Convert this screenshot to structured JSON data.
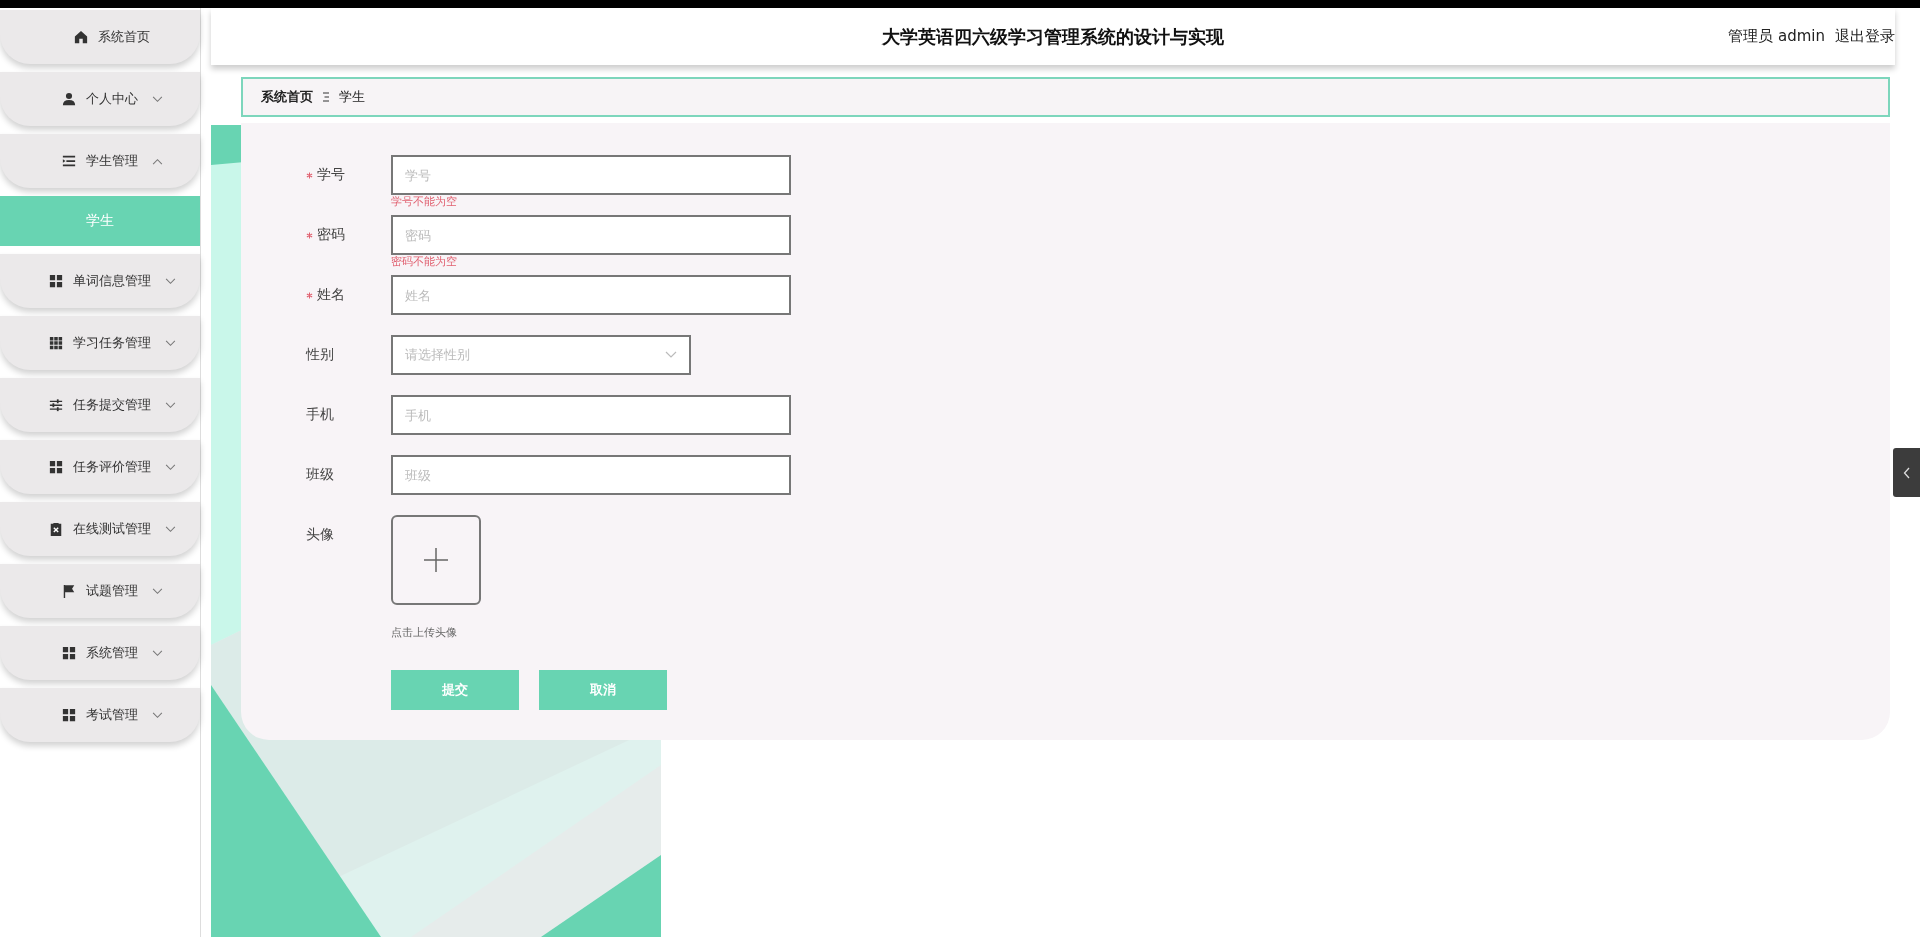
{
  "header": {
    "title": "大学英语四六级学习管理系统的设计与实现",
    "user": "管理员 admin",
    "logout": "退出登录"
  },
  "sidebar": {
    "items": [
      {
        "kind": "link",
        "label": "系统首页"
      },
      {
        "kind": "menu",
        "label": "个人中心",
        "expanded": false
      },
      {
        "kind": "menu",
        "label": "学生管理",
        "expanded": true,
        "children": [
          {
            "label": "学生",
            "selected": true
          }
        ]
      },
      {
        "kind": "menu",
        "label": "单词信息管理",
        "expanded": false
      },
      {
        "kind": "menu",
        "label": "学习任务管理",
        "expanded": false
      },
      {
        "kind": "menu",
        "label": "任务提交管理",
        "expanded": false
      },
      {
        "kind": "menu",
        "label": "任务评价管理",
        "expanded": false
      },
      {
        "kind": "menu",
        "label": "在线测试管理",
        "expanded": false
      },
      {
        "kind": "menu",
        "label": "试题管理",
        "expanded": false
      },
      {
        "kind": "menu",
        "label": "系统管理",
        "expanded": false
      },
      {
        "kind": "menu",
        "label": "考试管理",
        "expanded": false
      }
    ]
  },
  "breadcrumb": [
    {
      "label": "系统首页"
    },
    {
      "label": "学生"
    }
  ],
  "form": {
    "fields": [
      {
        "kind": "input",
        "label": "学号",
        "required": true,
        "placeholder": "学号",
        "error": "学号不能为空"
      },
      {
        "kind": "input",
        "label": "密码",
        "required": true,
        "placeholder": "密码",
        "error": "密码不能为空"
      },
      {
        "kind": "input",
        "label": "姓名",
        "required": true,
        "placeholder": "姓名"
      },
      {
        "kind": "select",
        "label": "性别",
        "required": false,
        "placeholder": "请选择性别"
      },
      {
        "kind": "input",
        "label": "手机",
        "required": false,
        "placeholder": "手机"
      },
      {
        "kind": "input",
        "label": "班级",
        "required": false,
        "placeholder": "班级"
      },
      {
        "kind": "upload",
        "label": "头像",
        "required": false,
        "hint": "点击上传头像"
      }
    ],
    "buttons": [
      "提交",
      "取消"
    ]
  }
}
